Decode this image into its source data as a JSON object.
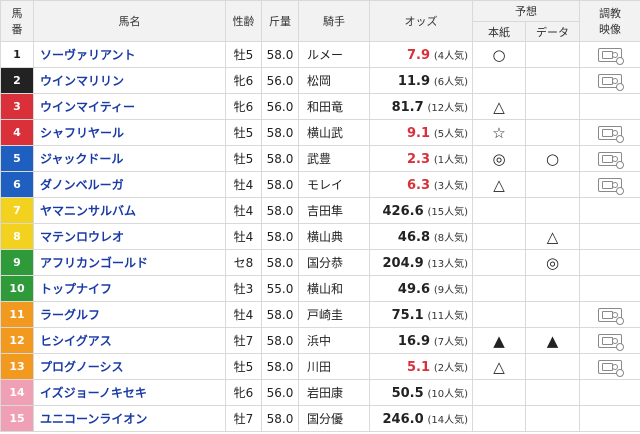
{
  "header": {
    "col_num": "馬\n番",
    "col_num_top": "馬",
    "col_num_bottom": "番",
    "col_name": "馬名",
    "col_sexage": "性齢",
    "col_weight": "斤量",
    "col_jockey": "騎手",
    "col_odds": "オッズ",
    "col_prediction": "予想",
    "col_paper": "本紙",
    "col_data": "データ",
    "col_training_top": "調教",
    "col_training_bottom": "映像"
  },
  "colors": {
    "1": {
      "bg": "#ffffff",
      "fg": "#222222"
    },
    "2": {
      "bg": "#222222",
      "fg": "#ffffff"
    },
    "3": {
      "bg": "#d9303a",
      "fg": "#ffffff"
    },
    "4": {
      "bg": "#d9303a",
      "fg": "#ffffff"
    },
    "5": {
      "bg": "#1f5fbf",
      "fg": "#ffffff"
    },
    "6": {
      "bg": "#1f5fbf",
      "fg": "#ffffff"
    },
    "7": {
      "bg": "#f3d21f",
      "fg": "#ffffff"
    },
    "8": {
      "bg": "#f3d21f",
      "fg": "#ffffff"
    },
    "9": {
      "bg": "#2f9a3a",
      "fg": "#ffffff"
    },
    "10": {
      "bg": "#2f9a3a",
      "fg": "#ffffff"
    },
    "11": {
      "bg": "#f29a1f",
      "fg": "#ffffff"
    },
    "12": {
      "bg": "#f29a1f",
      "fg": "#ffffff"
    },
    "13": {
      "bg": "#f29a1f",
      "fg": "#ffffff"
    },
    "14": {
      "bg": "#f0a0b4",
      "fg": "#ffffff"
    },
    "15": {
      "bg": "#f0a0b4",
      "fg": "#ffffff"
    }
  },
  "rows": [
    {
      "num": "1",
      "name": "ソーヴァリアント",
      "sexage": "牡5",
      "weight": "58.0",
      "jockey": "ルメー",
      "odds": "7.9",
      "pop": "(4人気)",
      "fav": true,
      "paper": "○",
      "data": "",
      "video": true
    },
    {
      "num": "2",
      "name": "ウインマリリン",
      "sexage": "牝6",
      "weight": "56.0",
      "jockey": "松岡",
      "odds": "11.9",
      "pop": "(6人気)",
      "fav": false,
      "paper": "",
      "data": "",
      "video": true
    },
    {
      "num": "3",
      "name": "ウインマイティー",
      "sexage": "牝6",
      "weight": "56.0",
      "jockey": "和田竜",
      "odds": "81.7",
      "pop": "(12人気)",
      "fav": false,
      "paper": "△",
      "data": "",
      "video": false
    },
    {
      "num": "4",
      "name": "シャフリヤール",
      "sexage": "牡5",
      "weight": "58.0",
      "jockey": "横山武",
      "odds": "9.1",
      "pop": "(5人気)",
      "fav": true,
      "paper": "☆",
      "data": "",
      "video": true
    },
    {
      "num": "5",
      "name": "ジャックドール",
      "sexage": "牡5",
      "weight": "58.0",
      "jockey": "武豊",
      "odds": "2.3",
      "pop": "(1人気)",
      "fav": true,
      "paper": "◎",
      "data": "○",
      "video": true
    },
    {
      "num": "6",
      "name": "ダノンベルーガ",
      "sexage": "牡4",
      "weight": "58.0",
      "jockey": "モレイ",
      "odds": "6.3",
      "pop": "(3人気)",
      "fav": true,
      "paper": "△",
      "data": "",
      "video": true
    },
    {
      "num": "7",
      "name": "ヤマニンサルバム",
      "sexage": "牡4",
      "weight": "58.0",
      "jockey": "吉田隼",
      "odds": "426.6",
      "pop": "(15人気)",
      "fav": false,
      "paper": "",
      "data": "",
      "video": false
    },
    {
      "num": "8",
      "name": "マテンロウレオ",
      "sexage": "牡4",
      "weight": "58.0",
      "jockey": "横山典",
      "odds": "46.8",
      "pop": "(8人気)",
      "fav": false,
      "paper": "",
      "data": "△",
      "video": false
    },
    {
      "num": "9",
      "name": "アフリカンゴールド",
      "sexage": "セ8",
      "weight": "58.0",
      "jockey": "国分恭",
      "odds": "204.9",
      "pop": "(13人気)",
      "fav": false,
      "paper": "",
      "data": "◎",
      "video": false
    },
    {
      "num": "10",
      "name": "トップナイフ",
      "sexage": "牡3",
      "weight": "55.0",
      "jockey": "横山和",
      "odds": "49.6",
      "pop": "(9人気)",
      "fav": false,
      "paper": "",
      "data": "",
      "video": false
    },
    {
      "num": "11",
      "name": "ラーグルフ",
      "sexage": "牡4",
      "weight": "58.0",
      "jockey": "戸崎圭",
      "odds": "75.1",
      "pop": "(11人気)",
      "fav": false,
      "paper": "",
      "data": "",
      "video": true
    },
    {
      "num": "12",
      "name": "ヒシイグアス",
      "sexage": "牡7",
      "weight": "58.0",
      "jockey": "浜中",
      "odds": "16.9",
      "pop": "(7人気)",
      "fav": false,
      "paper": "▲",
      "data": "▲",
      "video": true
    },
    {
      "num": "13",
      "name": "プログノーシス",
      "sexage": "牡5",
      "weight": "58.0",
      "jockey": "川田",
      "odds": "5.1",
      "pop": "(2人気)",
      "fav": true,
      "paper": "△",
      "data": "",
      "video": true
    },
    {
      "num": "14",
      "name": "イズジョーノキセキ",
      "sexage": "牝6",
      "weight": "56.0",
      "jockey": "岩田康",
      "odds": "50.5",
      "pop": "(10人気)",
      "fav": false,
      "paper": "",
      "data": "",
      "video": false
    },
    {
      "num": "15",
      "name": "ユニコーンライオン",
      "sexage": "牡7",
      "weight": "58.0",
      "jockey": "国分優",
      "odds": "246.0",
      "pop": "(14人気)",
      "fav": false,
      "paper": "",
      "data": "",
      "video": false
    }
  ]
}
